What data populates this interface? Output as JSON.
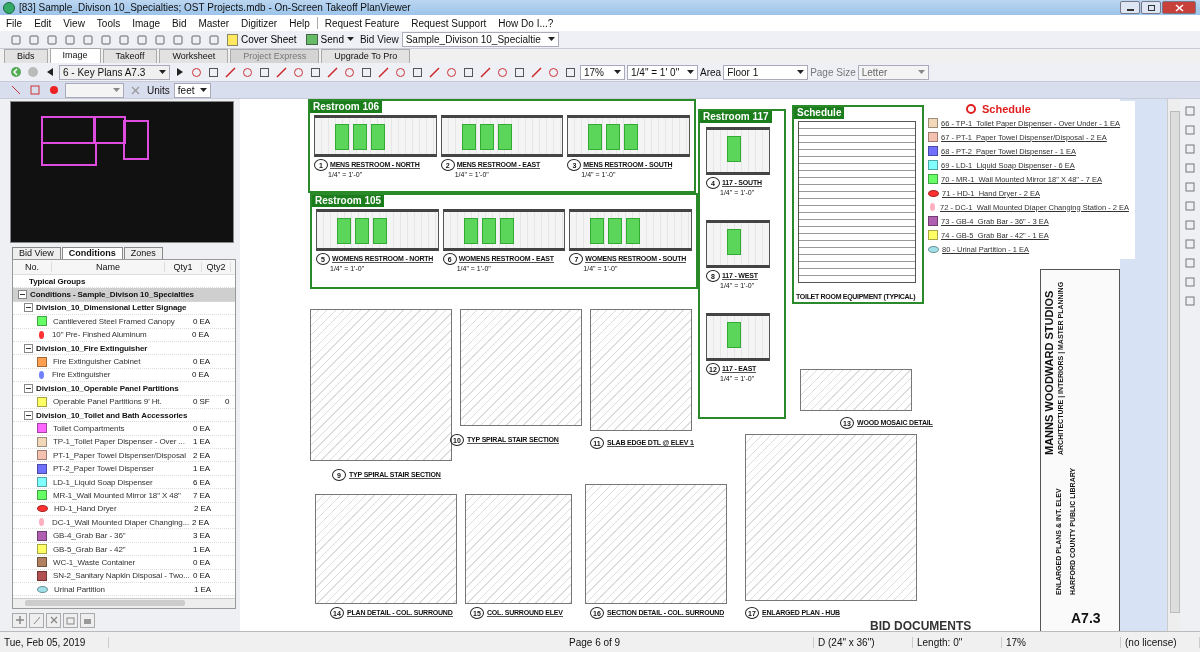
{
  "window": {
    "title": "[83] Sample_Divison 10_Specialties; OST Projects.mdb - On-Screen Takeoff PlanViewer"
  },
  "menu": [
    "File",
    "Edit",
    "View",
    "Tools",
    "Image",
    "Bid",
    "Master",
    "Digitizer",
    "Help"
  ],
  "menu_links": [
    "Request Feature",
    "Request Support",
    "How Do I...?"
  ],
  "toolbar": {
    "cover_sheet": "Cover Sheet",
    "send": "Send",
    "bid_view_label": "Bid View",
    "bid_value": "Sample_Divison 10_Specialtie"
  },
  "tabs": [
    {
      "label": "Bids",
      "selected": false,
      "disabled": false
    },
    {
      "label": "Image",
      "selected": true,
      "disabled": false
    },
    {
      "label": "Takeoff",
      "selected": false,
      "disabled": false
    },
    {
      "label": "Worksheet",
      "selected": false,
      "disabled": false
    },
    {
      "label": "Project Express",
      "selected": false,
      "disabled": true
    },
    {
      "label": "Upgrade To Pro",
      "selected": false,
      "disabled": false
    }
  ],
  "image_toolbar": {
    "page": "6 - Key Plans A7.3",
    "zoom": "17%",
    "scale": "1/4\" = 1' 0\"",
    "area_label": "Area",
    "area": "Floor 1",
    "page_size_label": "Page Size",
    "page_size": "Letter"
  },
  "units": {
    "label": "Units",
    "value": "feet"
  },
  "panel": {
    "tabs": [
      {
        "label": "Bid View",
        "selected": false
      },
      {
        "label": "Conditions",
        "selected": true
      },
      {
        "label": "Zones",
        "selected": false
      }
    ],
    "columns": [
      "No.",
      "Name",
      "Qty1",
      "Qty2"
    ],
    "typical_groups": "Typical Groups",
    "root": {
      "label": "Conditions - Sample_Divison 10_Specialties",
      "expanded": true,
      "children": [
        {
          "label": "Division_10_Dimensional Letter Signage",
          "expanded": true,
          "children": [
            {
              "name": "Cantilevered Steel Framed Canopy",
              "qty1": "0 EA",
              "kind": "swatch",
              "color": "#66ff66"
            },
            {
              "name": "10\" Pre- Finshed Aluminum",
              "qty1": "0 EA",
              "kind": "marker",
              "color": "#ff3030"
            }
          ]
        },
        {
          "label": "Division_10_Fire Extinguisher",
          "expanded": true,
          "children": [
            {
              "name": "Fire Extinguisher Cabinet",
              "qty1": "0 EA",
              "kind": "swatch",
              "color": "#ffa050"
            },
            {
              "name": "Fire Extinguisher",
              "qty1": "0 EA",
              "kind": "marker",
              "color": "#7080ff"
            }
          ]
        },
        {
          "label": "Division_10_Operable Panel Partitions",
          "expanded": true,
          "children": [
            {
              "name": "Operable Panel Partitions 9' Ht.",
              "qty1": "0 SF",
              "qty2": "0",
              "kind": "swatch",
              "color": "#ffff66"
            }
          ]
        },
        {
          "label": "Division_10_Toilet and Bath Accessories",
          "expanded": true,
          "children": [
            {
              "name": "Toilet Compartments",
              "qty1": "0 EA",
              "kind": "swatch",
              "color": "#ff66ff"
            },
            {
              "name": "TP-1_Toilet Paper Dispenser - Over ...",
              "qty1": "1 EA",
              "kind": "swatch",
              "color": "#f0d8b8"
            },
            {
              "name": "PT-1_Paper Towel Dispenser/Disposal",
              "qty1": "2 EA",
              "kind": "swatch",
              "color": "#f4c0b0"
            },
            {
              "name": "PT-2_Paper Towel Dispenser",
              "qty1": "1 EA",
              "kind": "swatch",
              "color": "#7070ff"
            },
            {
              "name": "LD-1_Liquid Soap Dispenser",
              "qty1": "6 EA",
              "kind": "swatch",
              "color": "#80ffff"
            },
            {
              "name": "MR-1_Wall Mounted Mirror 18\" X 48\"",
              "qty1": "7 EA",
              "kind": "swatch",
              "color": "#66ff66"
            },
            {
              "name": "HD-1_Hand Dryer",
              "qty1": "2 EA",
              "kind": "oval",
              "color": "#ff3030"
            },
            {
              "name": "DC-1_Wall Mounted Diaper Changing...",
              "qty1": "2 EA",
              "kind": "marker",
              "color": "#ffb0c0"
            },
            {
              "name": "GB-4_Grab Bar - 36\"",
              "qty1": "3 EA",
              "kind": "swatch",
              "color": "#b060b0"
            },
            {
              "name": "GB-5_Grab Bar - 42\"",
              "qty1": "1 EA",
              "kind": "swatch",
              "color": "#ffff66"
            },
            {
              "name": "WC-1_Waste Container",
              "qty1": "0 EA",
              "kind": "swatch",
              "color": "#b08060"
            },
            {
              "name": "SN-2_Sanitary Napkin Disposal - Two...",
              "qty1": "0 EA",
              "kind": "swatch",
              "color": "#b05050"
            },
            {
              "name": "Urinal Partition",
              "qty1": "1 EA",
              "kind": "oval",
              "color": "#a0e0e8"
            }
          ]
        }
      ]
    }
  },
  "sheet": {
    "restrooms": [
      {
        "label": "Restroom  106",
        "views": [
          {
            "number": "1",
            "title": "MENS RESTROOM - NORTH",
            "scale": "1/4\" = 1'-0\""
          },
          {
            "number": "2",
            "title": "MENS RESTROOM - EAST",
            "scale": "1/4\" = 1'-0\""
          },
          {
            "number": "3",
            "title": "MENS RESTROOM - SOUTH",
            "scale": "1/4\" = 1'-0\""
          }
        ]
      },
      {
        "label": "Restroom 105",
        "views": [
          {
            "number": "5",
            "title": "WOMENS RESTROOM - NORTH",
            "scale": "1/4\" = 1'-0\""
          },
          {
            "number": "6",
            "title": "WOMENS RESTROOM - EAST",
            "scale": "1/4\" = 1'-0\""
          },
          {
            "number": "7",
            "title": "WOMENS RESTROOM - SOUTH",
            "scale": "1/4\" = 1'-0\""
          }
        ]
      }
    ],
    "side_room": {
      "label": "Restroom 117",
      "views": [
        {
          "number": "4",
          "title": "117 - SOUTH",
          "scale": "1/4\" = 1'-0\""
        },
        {
          "number": "8",
          "title": "117 - WEST",
          "scale": "1/4\" = 1'-0\""
        },
        {
          "number": "12",
          "title": "117 - EAST",
          "scale": "1/4\" = 1'-0\""
        }
      ]
    },
    "schedule_frame": {
      "label": "Schedule",
      "table_title": "TOILET ROOM EQUIPMENT (TYPICAL)"
    },
    "schedule": {
      "title": "Schedule",
      "items": [
        {
          "text": "66 - TP-1_Toilet Paper Dispenser - Over Under - 1 EA",
          "kind": "swatch",
          "color": "#f0d8b8"
        },
        {
          "text": "67 - PT-1_Paper Towel Dispenser/Disposal - 2 EA",
          "kind": "swatch",
          "color": "#f4c0b0"
        },
        {
          "text": "68 - PT-2_Paper Towel Dispenser - 1 EA",
          "kind": "swatch",
          "color": "#7070ff"
        },
        {
          "text": "69 - LD-1_Liquid Soap Dispenser - 6 EA",
          "kind": "swatch",
          "color": "#80ffff"
        },
        {
          "text": "70 - MR-1_Wall Mounted Mirror 18\" X 48\" - 7 EA",
          "kind": "swatch",
          "color": "#66ff66"
        },
        {
          "text": "71 - HD-1_Hand Dryer - 2 EA",
          "kind": "oval",
          "color": "#ff3030"
        },
        {
          "text": "72 - DC-1_Wall Mounted Diaper Changing Station - 2 EA",
          "kind": "marker",
          "color": "#ffb0c0"
        },
        {
          "text": "73 - GB-4_Grab Bar - 36\" - 3 EA",
          "kind": "swatch",
          "color": "#b060b0"
        },
        {
          "text": "74 - GB-5_Grab Bar - 42\" - 1 EA",
          "kind": "swatch",
          "color": "#ffff66"
        },
        {
          "text": "80 - Urinal Partition - 1 EA",
          "kind": "oval",
          "color": "#a0e0e8"
        }
      ]
    },
    "details": [
      {
        "number": "9",
        "title": "TYP SPIRAL STAIR SECTION"
      },
      {
        "number": "10",
        "title": "TYP SPIRAL STAIR SECTION"
      },
      {
        "number": "11",
        "title": "SLAB EDGE DTL @ ELEV 1"
      },
      {
        "number": "13",
        "title": "WOOD MOSAIC DETAIL"
      },
      {
        "number": "14",
        "title": "PLAN DETAIL - COL. SURROUND"
      },
      {
        "number": "15",
        "title": "COL. SURROUND ELEV"
      },
      {
        "number": "16",
        "title": "SECTION DETAIL - COL. SURROUND"
      },
      {
        "number": "17",
        "title": "ENLARGED PLAN - HUB"
      }
    ],
    "firm": "MANNS WOODWARD STUDIOS",
    "firm_sub": "ARCHITECTURE | INTERIORS | MASTER PLANNING",
    "project": "HARFORD COUNTY PUBLIC LIBRARY",
    "sheet_title": "ENLARGED PLANS & INT. ELEV",
    "stamp": "BID DOCUMENTS",
    "sheet_number": "A7.3"
  },
  "status_bar": {
    "date": "Tue, Feb 05, 2019",
    "page": "Page 6 of 9",
    "paper": "D (24\" x 36\")",
    "length": "Length: 0\"",
    "zoom": "17%",
    "license": "(no license)"
  }
}
